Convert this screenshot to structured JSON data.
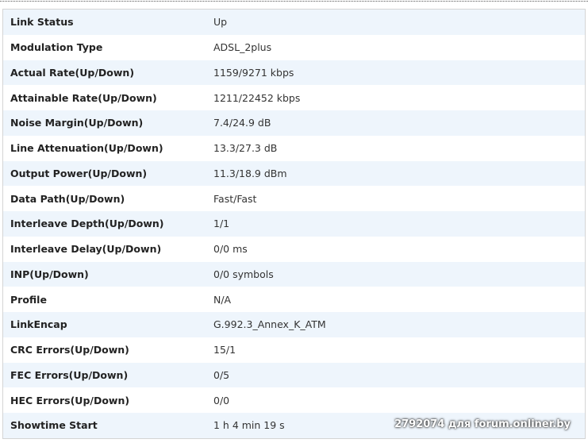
{
  "rows": [
    {
      "label": "Link Status",
      "value": "Up"
    },
    {
      "label": "Modulation Type",
      "value": "ADSL_2plus"
    },
    {
      "label": "Actual Rate(Up/Down)",
      "value": "1159/9271 kbps"
    },
    {
      "label": "Attainable Rate(Up/Down)",
      "value": "1211/22452 kbps"
    },
    {
      "label": "Noise Margin(Up/Down)",
      "value": "7.4/24.9 dB"
    },
    {
      "label": "Line Attenuation(Up/Down)",
      "value": "13.3/27.3 dB"
    },
    {
      "label": "Output Power(Up/Down)",
      "value": "11.3/18.9 dBm"
    },
    {
      "label": "Data Path(Up/Down)",
      "value": "Fast/Fast"
    },
    {
      "label": "Interleave Depth(Up/Down)",
      "value": "1/1"
    },
    {
      "label": "Interleave Delay(Up/Down)",
      "value": "0/0 ms"
    },
    {
      "label": "INP(Up/Down)",
      "value": "0/0 symbols"
    },
    {
      "label": "Profile",
      "value": "N/A"
    },
    {
      "label": "LinkEncap",
      "value": "G.992.3_Annex_K_ATM"
    },
    {
      "label": "CRC Errors(Up/Down)",
      "value": "15/1"
    },
    {
      "label": "FEC Errors(Up/Down)",
      "value": "0/5"
    },
    {
      "label": "HEC Errors(Up/Down)",
      "value": "0/0"
    },
    {
      "label": "Showtime Start",
      "value": "1 h 4 min 19 s"
    }
  ],
  "watermark": "2792074 для forum.onliner.by"
}
